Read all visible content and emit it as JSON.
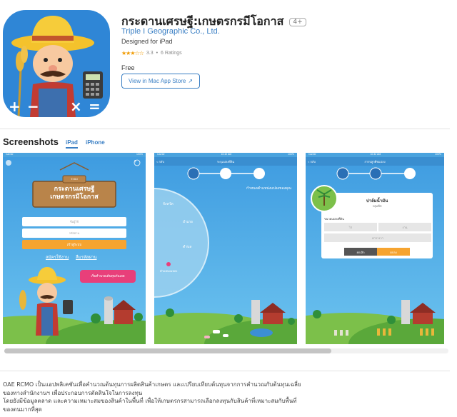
{
  "app": {
    "title": "กระดานเศรษฐี:เกษตรกรมีโอกาส",
    "age_rating": "4+",
    "developer": "Triple I Geographic Co., Ltd.",
    "designed_for": "Designed for iPad",
    "rating_value": "3.3",
    "rating_count": "6 Ratings",
    "stars": "★★★☆☆",
    "price": "Free",
    "store_button": "View in Mac App Store",
    "store_button_icon": "external-arrow-icon"
  },
  "screenshots": {
    "title": "Screenshots",
    "tabs": [
      {
        "label": "iPad",
        "active": true
      },
      {
        "label": "iPhone",
        "active": false
      }
    ],
    "shot1": {
      "status_left": "Carrier",
      "status_right": "100%",
      "sign_top": "ระบบ",
      "sign_line1": "กระดานเศรษฐี",
      "sign_line2": "เกษตรกรมีโอกาส",
      "login_button": "เข้าสู่ระบบ",
      "register_link": "สมัครใช้งาน",
      "forgot_link": "ลืมรหัสผ่าน",
      "speech": "เริ่มคำนวณต้นทุนกันเลย",
      "username_placeholder": "ชื่อผู้ใช้",
      "password_placeholder": "รหัสผ่าน",
      "help": "?"
    },
    "shot2": {
      "status_left": "Carrier",
      "status_mid": "10:42 AM",
      "status_right": "100%",
      "back": "< กลับ",
      "nav_title": "ระบุแปลงที่ดิน",
      "heading": "กำหนดตำแหน่งแปลงของคุณ",
      "menu": [
        "จังหวัด",
        "อำเภอ",
        "ตำบล",
        "ตำแหน่งแปลง"
      ]
    },
    "shot3": {
      "status_left": "Carrier",
      "status_mid": "10:42 AM",
      "status_right": "100%",
      "back": "< กลับ",
      "nav_title": "การปลูกพืชแปลง",
      "crop": "ปาล์มน้ำมัน",
      "crop_sub": "กลุ่มพืช",
      "field_label": "ขนาดแปลงที่ดิน",
      "field_unit": "ไร่",
      "field2": "งาน",
      "field3": "ตารางวา",
      "cancel": "ยกเลิก",
      "ok": "ตกลง"
    }
  },
  "description": {
    "lines": [
      "OAE RCMO เป็นแอปพลิเคชันเพื่อคำนวณต้นทุนการผลิตสินค้าเกษตร และเปรียบเทียบต้นทุนจากการคำนวณกับต้นทุนเฉลี่ย",
      "ของทางสำนักงานฯ เพื่อประกอบการตัดสินใจในการลงทุน",
      "โดยยังมีข้อมูลตลาด และความเหมาะสมของสินค้าในพื้นที่ เพื่อให้เกษตรกรสามารถเลือกลงทุนกับสินค้าที่เหมาะสมกับพื้นที่",
      "ของตนมากที่สุด"
    ]
  },
  "colors": {
    "accent": "#3a7fc4",
    "sky": "#4aa3de",
    "orange": "#f6a430",
    "pink": "#e83f7a",
    "grass": "#6cb33f"
  }
}
